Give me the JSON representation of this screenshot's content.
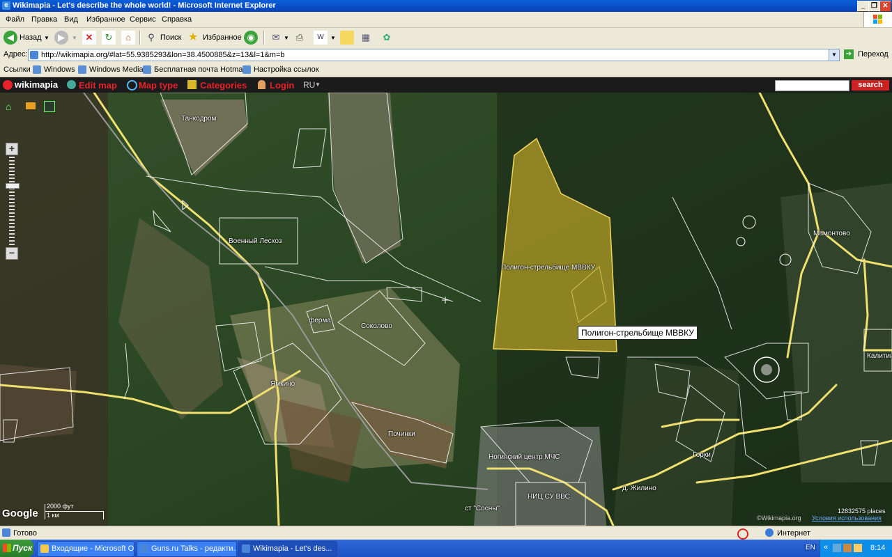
{
  "window": {
    "title": "Wikimapia - Let's describe the whole world! - Microsoft Internet Explorer",
    "buttons": [
      "_",
      "❐",
      "✕"
    ]
  },
  "menu": [
    "Файл",
    "Правка",
    "Вид",
    "Избранное",
    "Сервис",
    "Справка"
  ],
  "toolbar": {
    "back_label": "Назад",
    "search_label": "Поиск",
    "favorites_label": "Избранное"
  },
  "address": {
    "label": "Адрес:",
    "url": "http://wikimapia.org/#lat=55.9385293&lon=38.4500885&z=13&l=1&m=b",
    "go_label": "Переход"
  },
  "links": {
    "label": "Ссылки",
    "items": [
      "Windows",
      "Windows Media",
      "Бесплатная почта Hotmail",
      "Настройка ссылок"
    ]
  },
  "wikimapia": {
    "logo": "wikimapia",
    "edit_map": "Edit map",
    "map_type": "Map type",
    "categories": "Categories",
    "login": "Login",
    "language": "RU",
    "search_button": "search"
  },
  "map": {
    "labels": {
      "tankodrom": "Танкодром",
      "voenny_leskhoz": "Военный Лесхоз",
      "poligon": "Полигон-стрельбище МВВКУ",
      "ferma": "ферма",
      "sokolovo": "Соколово",
      "yamkino": "Ямкино",
      "pochinki": "Починки",
      "noginsky_center": "Ногинский центр МЧС",
      "nits_su_vvs": "НИЦ СУ ВВС",
      "sosny": "ст \"Сосны\"",
      "d_zhilino": "д. Жилино",
      "gorki": "Горки",
      "mamontovo": "Мамонтово",
      "kalitin": "Калитин"
    },
    "tooltip": "Полигон-стрельбище МВВКУ",
    "places_count": "12832575 places",
    "copyright": "©Wikimapia.org",
    "terms": "Условия использования",
    "scale_top": "2000 фут",
    "scale_bottom": "1 км",
    "google": "Google",
    "zoom_in": "+",
    "zoom_out": "−"
  },
  "status": {
    "text": "Готово",
    "zone": "Интернет"
  },
  "taskbar": {
    "start": "Пуск",
    "tasks": [
      "Входящие - Microsoft O...",
      "Guns.ru Talks - редакти...",
      "Wikimapia - Let's des..."
    ],
    "lang": "EN",
    "time": "8:14"
  },
  "colors": {
    "wm_red": "#e8222a",
    "polygon_yellow": "#d9b92a",
    "road_yellow": "#f0e070"
  }
}
